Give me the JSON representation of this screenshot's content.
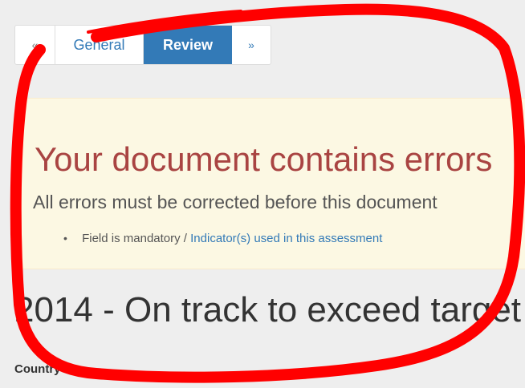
{
  "pager": {
    "prev": "«",
    "tabs": [
      {
        "label": "General",
        "active": false
      },
      {
        "label": "Review",
        "active": true
      }
    ],
    "next": "»"
  },
  "alert": {
    "title": "Your document contains errors",
    "subtitle": "All errors must be corrected before this document",
    "items": [
      {
        "field_text": "Field is mandatory / ",
        "link_text": "Indicator(s) used in this assessment"
      }
    ]
  },
  "page": {
    "heading": "2014 - On track to exceed target",
    "country_label": "Country"
  },
  "annotation": {
    "stroke_color": "#ff0000"
  }
}
